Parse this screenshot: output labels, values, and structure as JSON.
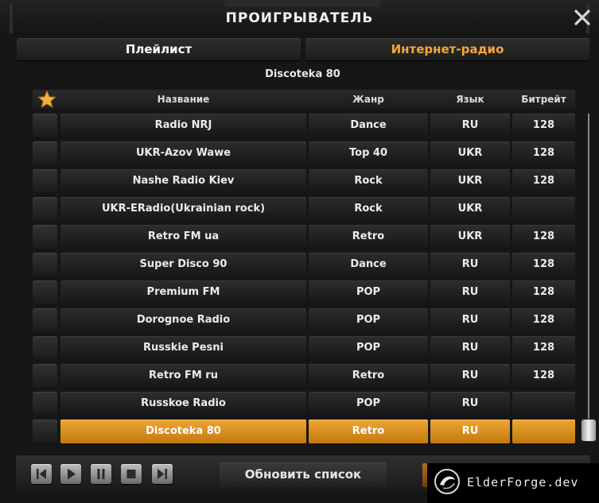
{
  "window": {
    "title": "ПРОИГРЫВАТЕЛЬ",
    "close_icon": "close-icon"
  },
  "tabs": [
    {
      "label": "Плейлист",
      "active": false
    },
    {
      "label": "Интернет-радио",
      "active": true,
      "color": "#f2a93b"
    }
  ],
  "playlist_name": "Discoteka 80",
  "table": {
    "favorite_icon": "star-icon",
    "columns": [
      "Название",
      "Жанр",
      "Язык",
      "Битрейт"
    ],
    "rows": [
      {
        "name": "Radio NRJ",
        "genre": "Dance",
        "lang": "RU",
        "bitrate": "128"
      },
      {
        "name": "UKR-Azov Wawe",
        "genre": "Top 40",
        "lang": "UKR",
        "bitrate": "128"
      },
      {
        "name": "Nashe Radio Kiev",
        "genre": "Rock",
        "lang": "UKR",
        "bitrate": "128"
      },
      {
        "name": "UKR-ERadio(Ukrainian rock)",
        "genre": "Rock",
        "lang": "UKR",
        "bitrate": ""
      },
      {
        "name": "Retro FM ua",
        "genre": "Retro",
        "lang": "UKR",
        "bitrate": "128"
      },
      {
        "name": "Super Disco 90",
        "genre": "Dance",
        "lang": "RU",
        "bitrate": "128"
      },
      {
        "name": "Premium FM",
        "genre": "POP",
        "lang": "RU",
        "bitrate": "128"
      },
      {
        "name": "Dorognoe Radio",
        "genre": "POP",
        "lang": "RU",
        "bitrate": "128"
      },
      {
        "name": "Russkie Pesni",
        "genre": "POP",
        "lang": "RU",
        "bitrate": "128"
      },
      {
        "name": "Retro FM ru",
        "genre": "Retro",
        "lang": "RU",
        "bitrate": "128"
      },
      {
        "name": "Russkoe Radio",
        "genre": "POP",
        "lang": "RU",
        "bitrate": ""
      },
      {
        "name": "Discoteka 80",
        "genre": "Retro",
        "lang": "RU",
        "bitrate": "",
        "selected": true
      }
    ]
  },
  "controls": {
    "buttons": [
      "previous-icon",
      "play-icon",
      "pause-icon",
      "stop-icon",
      "next-icon"
    ],
    "refresh_label": "Обновить список"
  },
  "watermark": {
    "text": "ElderForge.dev"
  },
  "colors": {
    "accent": "#f2a93b",
    "selected_row": "#dd9321",
    "background": "#161616"
  }
}
